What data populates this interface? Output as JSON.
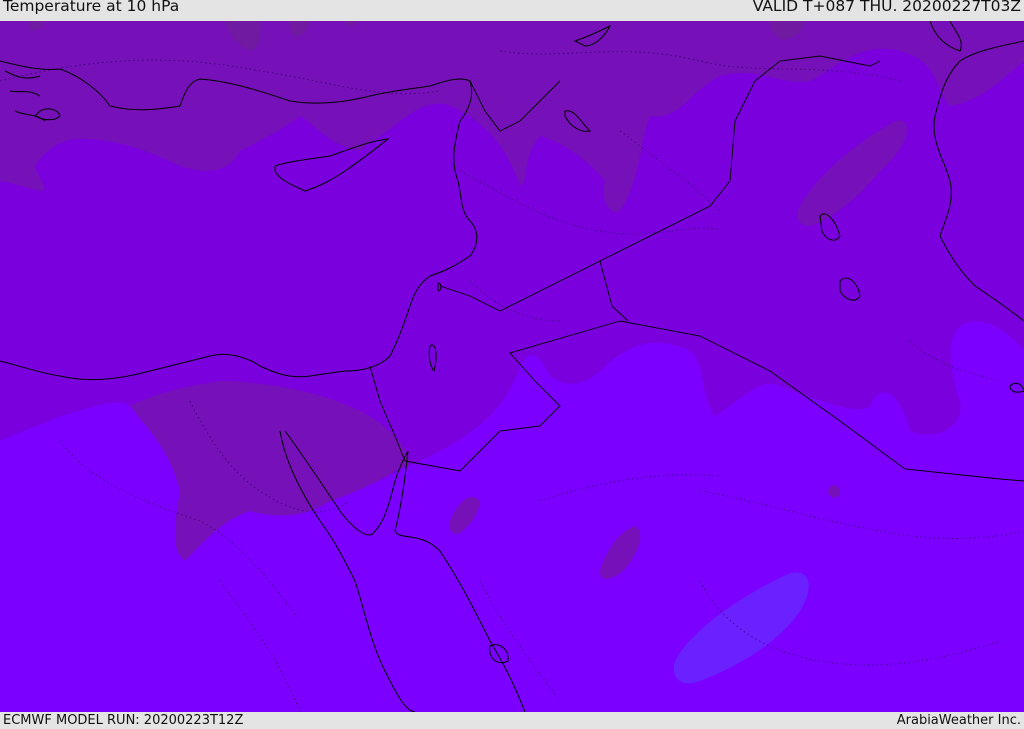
{
  "header": {
    "title": "Temperature at 10 hPa",
    "valid_time": "VALID T+087 THU. 20200227T03Z"
  },
  "footer": {
    "model_run": "ECMWF MODEL RUN: 20200223T12Z",
    "credit": "ArabiaWeather Inc."
  },
  "colors": {
    "band_cold": "#7b00ff",
    "band_mid": "#7a00de",
    "band_warm": "#7610b8",
    "band_warmest": "#6f1aa0",
    "band_coldest": "#6a20ff",
    "coastline": "#000000",
    "border": "#000000"
  }
}
